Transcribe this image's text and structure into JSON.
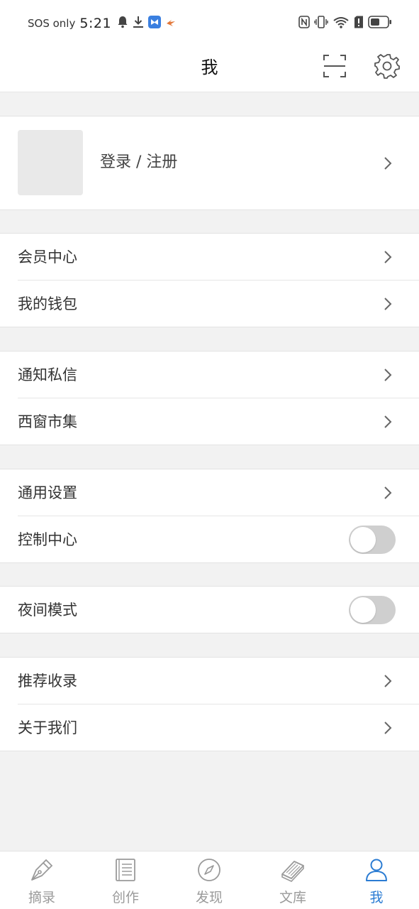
{
  "status_bar": {
    "carrier": "SOS only",
    "time": "5:21"
  },
  "header": {
    "title": "我"
  },
  "profile": {
    "login_label": "登录 / 注册"
  },
  "groups": [
    {
      "items": [
        {
          "label": "会员中心",
          "control": "chevron"
        },
        {
          "label": "我的钱包",
          "control": "chevron"
        }
      ]
    },
    {
      "items": [
        {
          "label": "通知私信",
          "control": "chevron"
        },
        {
          "label": "西窗市集",
          "control": "chevron"
        }
      ]
    },
    {
      "items": [
        {
          "label": "通用设置",
          "control": "chevron"
        },
        {
          "label": "控制中心",
          "control": "toggle",
          "on": false
        }
      ]
    },
    {
      "items": [
        {
          "label": "夜间模式",
          "control": "toggle",
          "on": false
        }
      ]
    },
    {
      "items": [
        {
          "label": "推荐收录",
          "control": "chevron"
        },
        {
          "label": "关于我们",
          "control": "chevron"
        }
      ]
    }
  ],
  "bottom_nav": {
    "tabs": [
      {
        "label": "摘录",
        "icon": "pen-nib-icon",
        "active": false
      },
      {
        "label": "创作",
        "icon": "document-icon",
        "active": false
      },
      {
        "label": "发现",
        "icon": "compass-icon",
        "active": false
      },
      {
        "label": "文库",
        "icon": "books-icon",
        "active": false
      },
      {
        "label": "我",
        "icon": "person-icon",
        "active": true
      }
    ]
  },
  "colors": {
    "accent": "#2b7cd3",
    "inactive": "#9a9a9a",
    "background": "#f2f2f2",
    "toggle_off": "#cfcfcf"
  }
}
